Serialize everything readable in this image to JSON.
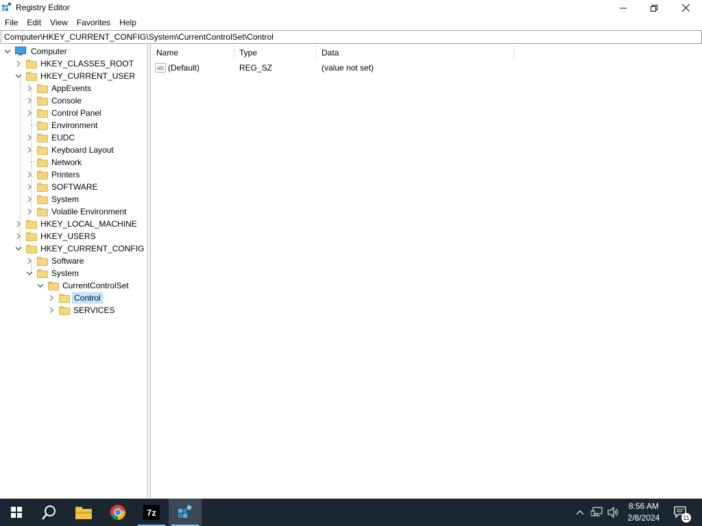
{
  "window": {
    "title": "Registry Editor",
    "controls": {
      "minimize": "minimize",
      "restore": "restore",
      "close": "close"
    }
  },
  "menu": [
    "File",
    "Edit",
    "View",
    "Favorites",
    "Help"
  ],
  "address": "Computer\\HKEY_CURRENT_CONFIG\\System\\CurrentControlSet\\Control",
  "tree": {
    "root": "Computer",
    "nodes": [
      {
        "label": "HKEY_CLASSES_ROOT",
        "level": 1,
        "state": "collapsed"
      },
      {
        "label": "HKEY_CURRENT_USER",
        "level": 1,
        "state": "expanded"
      },
      {
        "label": "AppEvents",
        "level": 2,
        "state": "collapsed"
      },
      {
        "label": "Console",
        "level": 2,
        "state": "collapsed"
      },
      {
        "label": "Control Panel",
        "level": 2,
        "state": "collapsed"
      },
      {
        "label": "Environment",
        "level": 2,
        "state": "leaf"
      },
      {
        "label": "EUDC",
        "level": 2,
        "state": "collapsed"
      },
      {
        "label": "Keyboard Layout",
        "level": 2,
        "state": "collapsed"
      },
      {
        "label": "Network",
        "level": 2,
        "state": "leaf"
      },
      {
        "label": "Printers",
        "level": 2,
        "state": "collapsed"
      },
      {
        "label": "SOFTWARE",
        "level": 2,
        "state": "collapsed"
      },
      {
        "label": "System",
        "level": 2,
        "state": "collapsed"
      },
      {
        "label": "Volatile Environment",
        "level": 2,
        "state": "collapsed"
      },
      {
        "label": "HKEY_LOCAL_MACHINE",
        "level": 1,
        "state": "collapsed"
      },
      {
        "label": "HKEY_USERS",
        "level": 1,
        "state": "collapsed"
      },
      {
        "label": "HKEY_CURRENT_CONFIG",
        "level": 1,
        "state": "expanded"
      },
      {
        "label": "Software",
        "level": 2,
        "state": "collapsed"
      },
      {
        "label": "System",
        "level": 2,
        "state": "expanded"
      },
      {
        "label": "CurrentControlSet",
        "level": 3,
        "state": "expanded"
      },
      {
        "label": "Control",
        "level": 4,
        "state": "collapsed",
        "selected": true
      },
      {
        "label": "SERVICES",
        "level": 4,
        "state": "collapsed"
      }
    ]
  },
  "list": {
    "columns": [
      "Name",
      "Type",
      "Data"
    ],
    "rows": [
      {
        "name": "(Default)",
        "type": "REG_SZ",
        "data": "(value not set)",
        "icon": "string-value-icon"
      }
    ]
  },
  "taskbar": {
    "apps": [
      "start-icon",
      "search-icon",
      "file-explorer-icon",
      "chrome-icon",
      "7zip-icon",
      "registry-editor-icon"
    ],
    "sevenzip_label": "7z",
    "clock": {
      "time": "8:56 AM",
      "date": "2/8/2024"
    },
    "notification_count": "11",
    "accent": "#88c5f5",
    "background": "#1b2631"
  }
}
